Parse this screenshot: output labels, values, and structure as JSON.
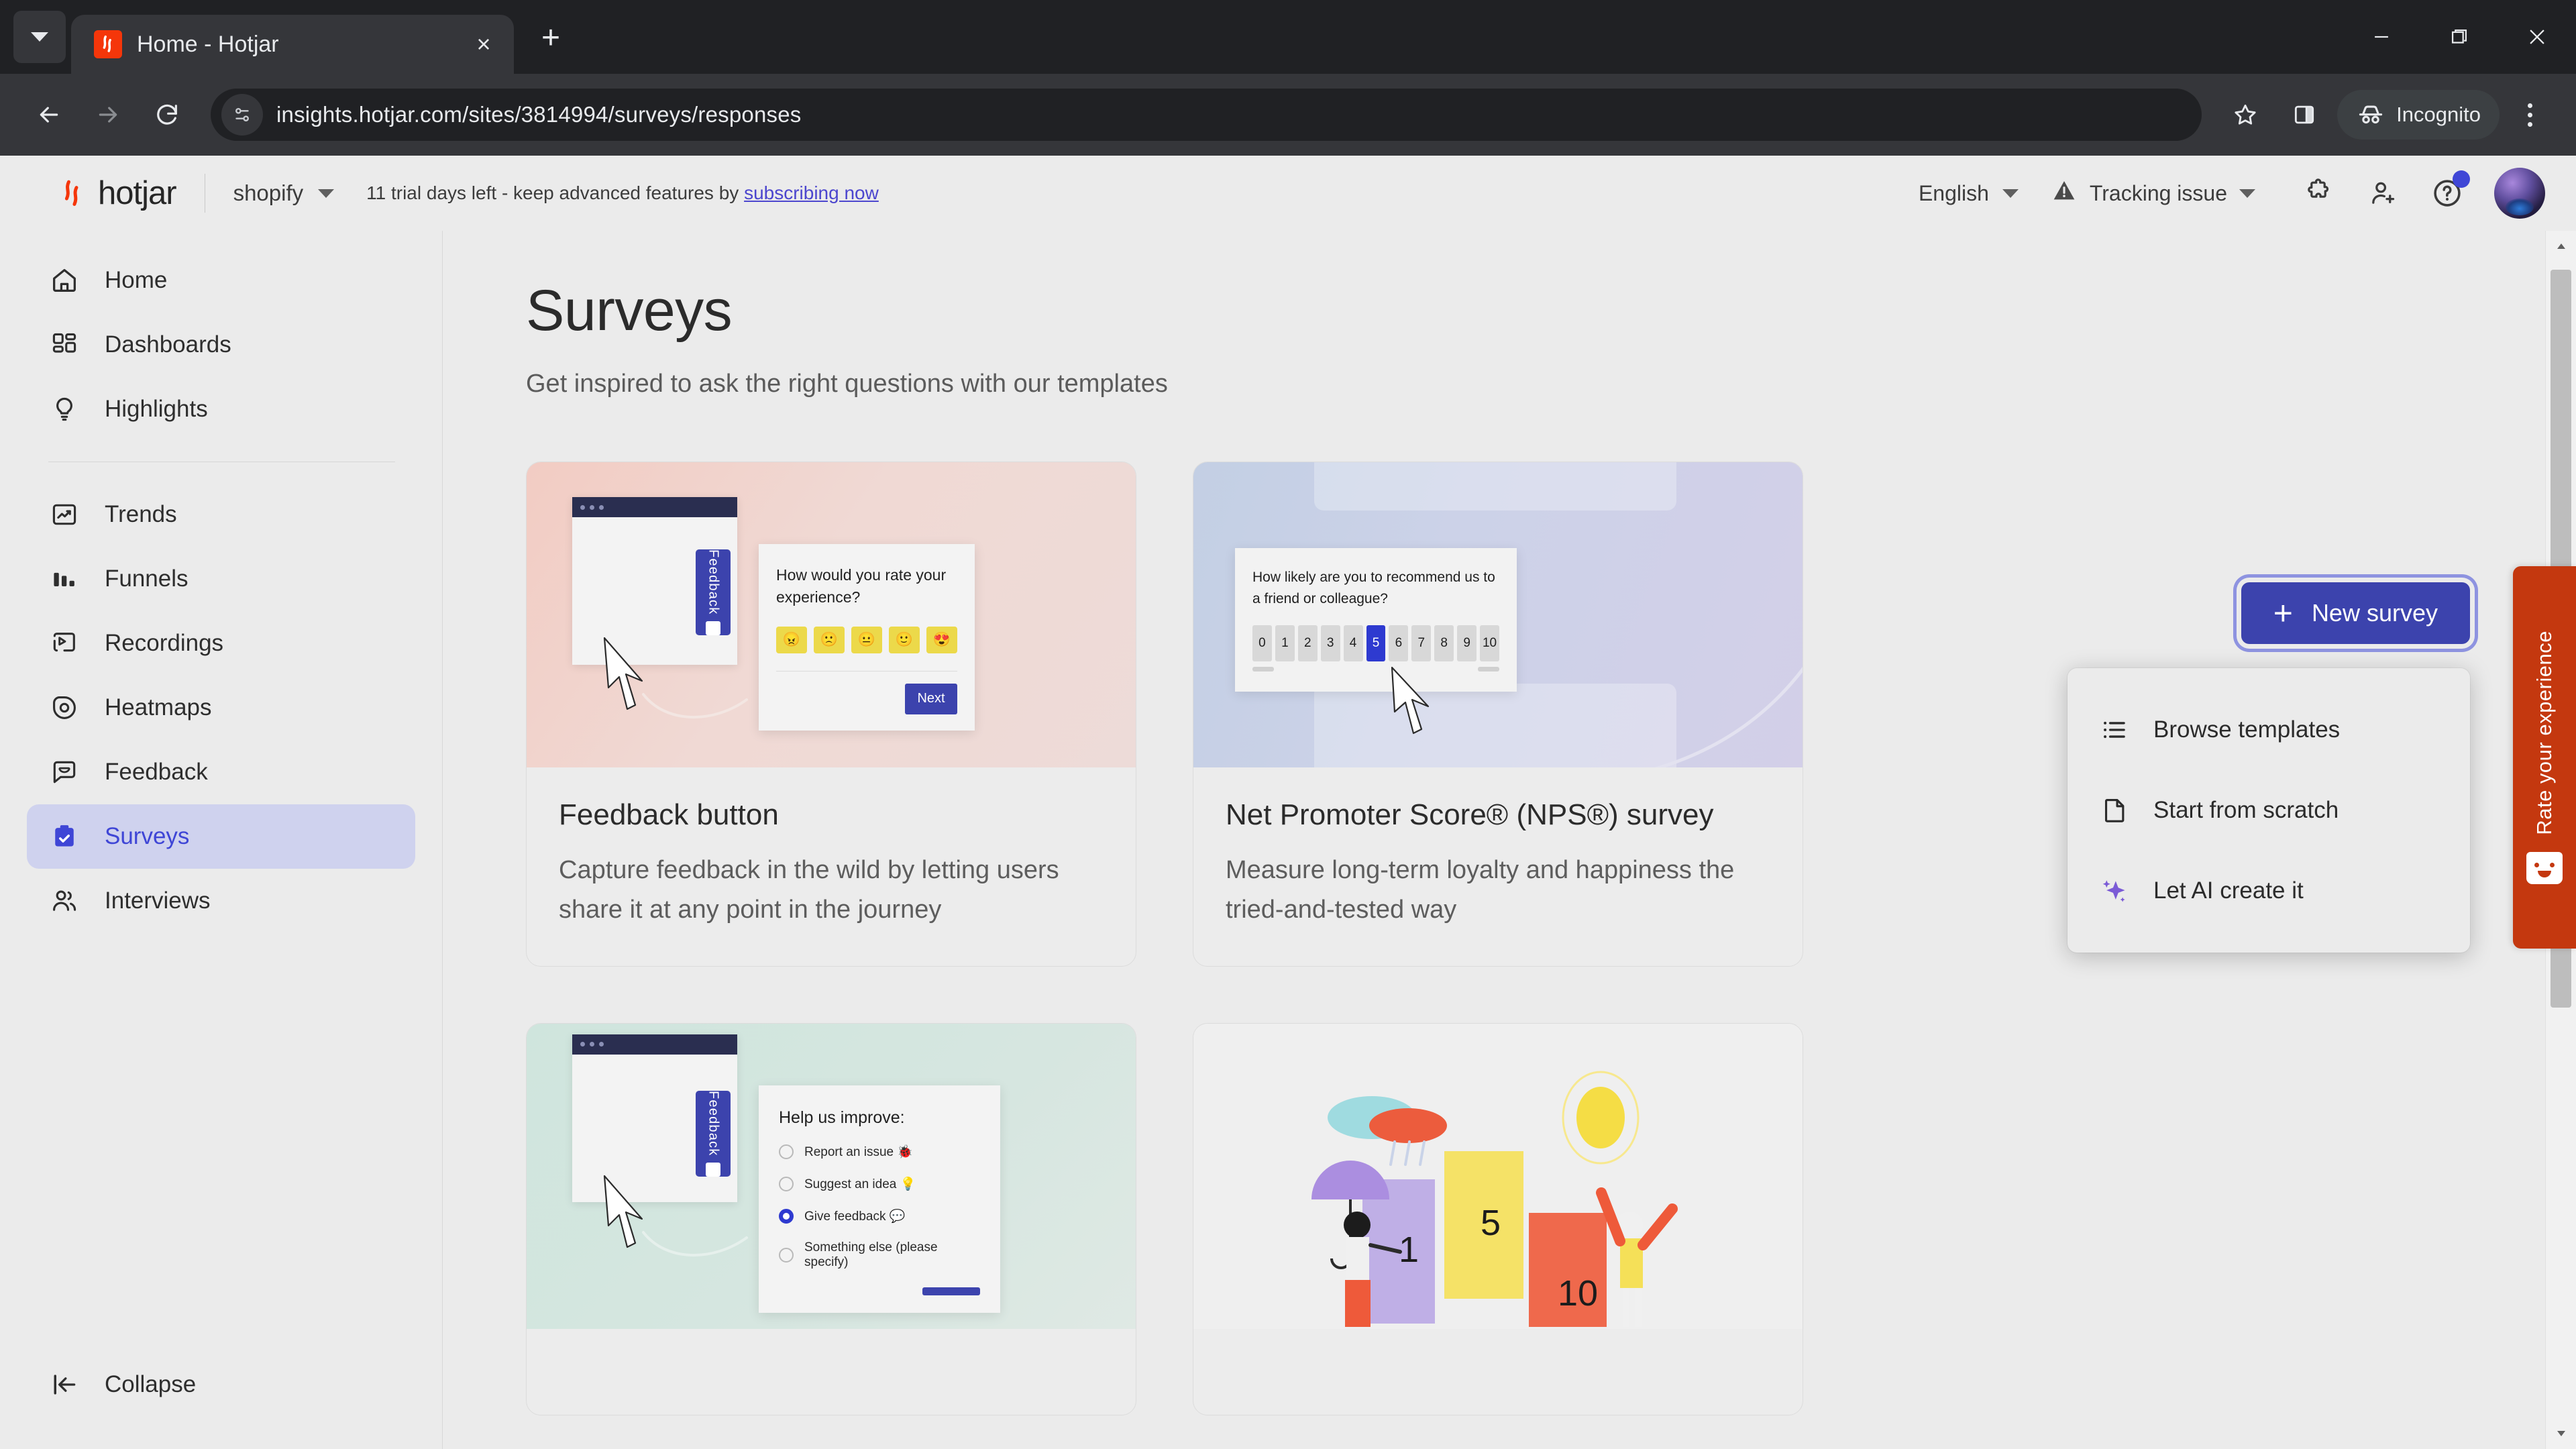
{
  "browser": {
    "tab": {
      "title": "Home - Hotjar",
      "favicon": "hotjar-favicon"
    },
    "new_tab_label": "+",
    "close_label": "×",
    "url": "insights.hotjar.com/sites/3814994/surveys/responses",
    "profile_label": "Incognito",
    "window_controls": {
      "minimize": "minimize-icon",
      "maximize": "maximize-icon",
      "close": "close-icon"
    },
    "toolbar_icons": [
      "back-icon",
      "forward-icon",
      "reload-icon",
      "bookmark-star-icon",
      "side-panel-icon",
      "kebab-menu-icon"
    ]
  },
  "app_header": {
    "logo_text": "hotjar",
    "site_selector": "shopify",
    "trial_text": "11 trial days left - keep advanced features by ",
    "trial_link": "subscribing now",
    "language": "English",
    "tracking_status": "Tracking issue",
    "icons": [
      "puzzle-icon",
      "add-user-icon",
      "help-icon"
    ],
    "avatar": "user-avatar"
  },
  "sidebar": {
    "items": [
      {
        "label": "Home",
        "icon": "home-icon",
        "active": false
      },
      {
        "label": "Dashboards",
        "icon": "dashboards-icon",
        "active": false
      },
      {
        "label": "Highlights",
        "icon": "lightbulb-icon",
        "active": false
      },
      {
        "label": "Trends",
        "icon": "trends-icon",
        "active": false
      },
      {
        "label": "Funnels",
        "icon": "funnels-icon",
        "active": false
      },
      {
        "label": "Recordings",
        "icon": "recordings-icon",
        "active": false
      },
      {
        "label": "Heatmaps",
        "icon": "heatmaps-icon",
        "active": false
      },
      {
        "label": "Feedback",
        "icon": "feedback-icon",
        "active": false
      },
      {
        "label": "Surveys",
        "icon": "surveys-clipboard-icon",
        "active": true
      },
      {
        "label": "Interviews",
        "icon": "interviews-icon",
        "active": false
      }
    ],
    "collapse_label": "Collapse",
    "collapse_icon": "collapse-left-icon",
    "active_color": "#3f46d6",
    "active_bg": "#cfd2ee"
  },
  "main": {
    "title": "Surveys",
    "subtitle": "Get inspired to ask the right questions with our templates",
    "new_survey_label": "New survey",
    "new_survey_plus": "+",
    "accent_color": "#3c43ad"
  },
  "dropdown": {
    "items": [
      {
        "label": "Browse templates",
        "icon": "list-icon"
      },
      {
        "label": "Start from scratch",
        "icon": "document-icon"
      },
      {
        "label": "Let AI create it",
        "icon": "ai-sparkle-icon"
      }
    ]
  },
  "cards": [
    {
      "title": "Feedback button",
      "description": "Capture feedback in the wild by letting users share it at any point in the journey",
      "art": {
        "kind": "feedback-button",
        "tab_label": "Feedback",
        "question": "How would you rate your experience?",
        "emojis": [
          "😠",
          "🙁",
          "😐",
          "🙂",
          "😍"
        ],
        "next_label": "Next"
      }
    },
    {
      "title": "Net Promoter Score® (NPS®) survey",
      "description": "Measure long-term loyalty and happiness the tried-and-tested way",
      "art": {
        "kind": "nps",
        "question": "How likely are you to recommend us to a friend or colleague?",
        "scale": [
          "0",
          "1",
          "2",
          "3",
          "4",
          "5",
          "6",
          "7",
          "8",
          "9",
          "10"
        ],
        "selected": "5"
      }
    },
    {
      "title": "",
      "description": "",
      "art": {
        "kind": "help-us-improve",
        "tab_label": "Feedback",
        "question": "Help us improve:",
        "options": [
          {
            "label": "Report an issue 🐞",
            "selected": false
          },
          {
            "label": "Suggest an idea 💡",
            "selected": false
          },
          {
            "label": "Give feedback 💬",
            "selected": true
          },
          {
            "label": "Something else (please specify)",
            "selected": false
          }
        ]
      }
    },
    {
      "title": "",
      "description": "",
      "art": {
        "kind": "illustration-scale",
        "numbers": [
          "1",
          "5",
          "10"
        ]
      }
    }
  ],
  "rate_widget": {
    "label": "Rate your experience",
    "icon": "smiley-face-icon",
    "color": "#c4380f"
  },
  "scrollbar": {
    "up_icon": "scroll-up-arrow",
    "down_icon": "scroll-down-arrow"
  }
}
